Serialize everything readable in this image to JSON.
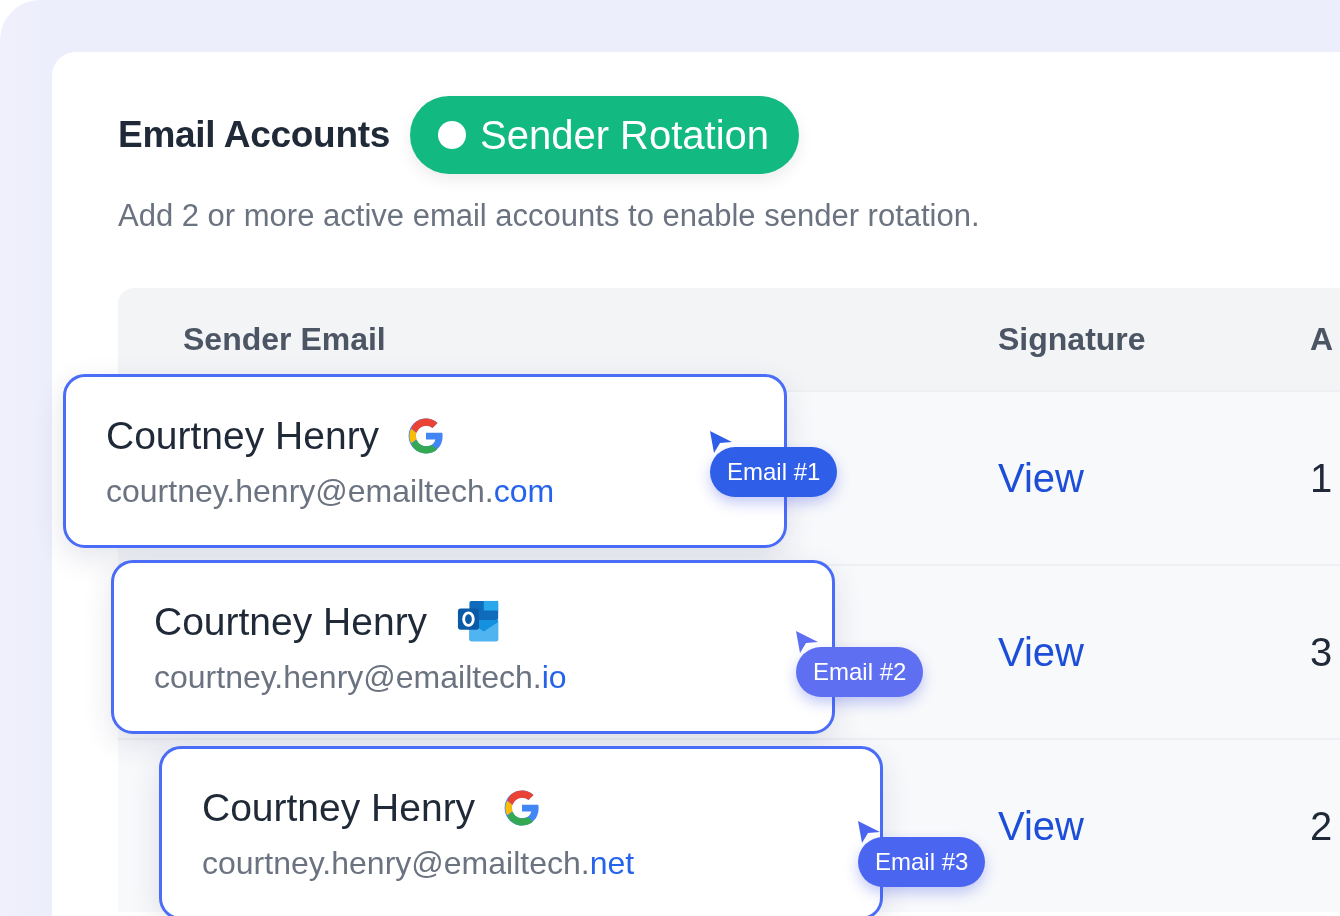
{
  "header": {
    "title": "Email Accounts",
    "badge": "Sender Rotation",
    "subtitle": "Add 2 or more active email accounts to enable sender rotation."
  },
  "table": {
    "columns": [
      "Sender Email",
      "Signature",
      "A"
    ],
    "rows": [
      {
        "name": "Courtney Henry",
        "kind": "google",
        "address": "courtney.henry@emailtech.",
        "tld": "com",
        "tag": "Email #1",
        "color": "#2f5fe9",
        "signature": "View",
        "column_3": "1"
      },
      {
        "name": "Courtney Henry",
        "kind": "outlook",
        "address": "courtney.henry@emailtech.",
        "tld": "io",
        "tag": "Email #2",
        "color": "#5f6ff2",
        "signature": "View",
        "column_3": "3"
      },
      {
        "name": "Courtney Henry",
        "kind": "google",
        "address": "courtney.henry@emailtech.",
        "tld": "net",
        "tag": "Email #3",
        "color": "#4a66f0",
        "signature": "View",
        "column_3": "2"
      }
    ]
  }
}
